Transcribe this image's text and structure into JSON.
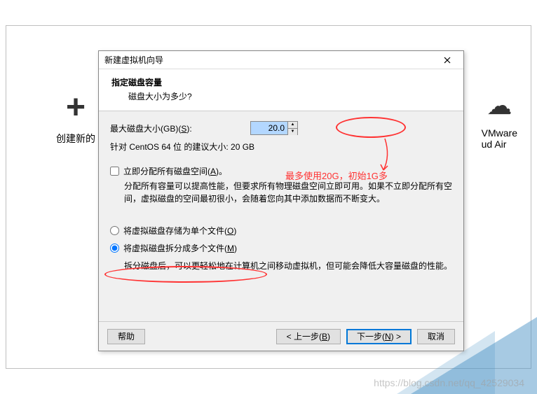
{
  "bg": {
    "create_label": "创建新的",
    "right_line1": "VMware",
    "right_line2": "ud Air"
  },
  "dialog": {
    "window_title": "新建虚拟机向导",
    "header_title": "指定磁盘容量",
    "header_sub": "磁盘大小为多少?",
    "disk_size_label": "最大磁盘大小(GB)(S):",
    "disk_size_value": "20.0",
    "recommend": "针对 CentOS 64 位 的建议大小: 20 GB",
    "annotation": "最多使用20G，初始1G多",
    "checkbox_label": "立即分配所有磁盘空间(A)。",
    "checkbox_desc": "分配所有容量可以提高性能，但要求所有物理磁盘空间立即可用。如果不立即分配所有空间，虚拟磁盘的空间最初很小，会随着您向其中添加数据而不断变大。",
    "radio1_label": "将虚拟磁盘存储为单个文件(O)",
    "radio2_label": "将虚拟磁盘拆分成多个文件(M)",
    "radio_desc": "拆分磁盘后，可以更轻松地在计算机之间移动虚拟机，但可能会降低大容量磁盘的性能。",
    "buttons": {
      "help": "帮助",
      "back": "< 上一步(B)",
      "next": "下一步(N) >",
      "cancel": "取消"
    }
  },
  "watermark": "https://blog.csdn.net/qq_42529034"
}
